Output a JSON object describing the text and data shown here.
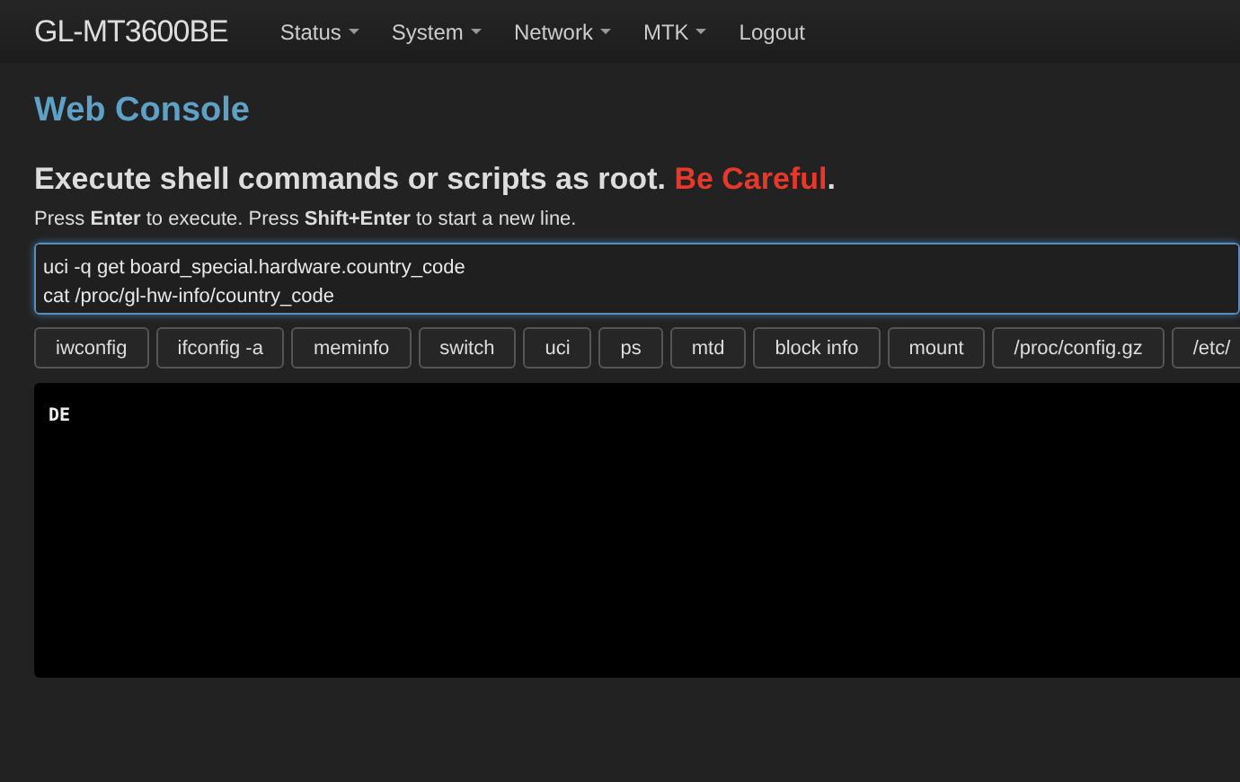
{
  "navbar": {
    "brand": "GL-MT3600BE",
    "menu": [
      {
        "label": "Status",
        "dropdown": true
      },
      {
        "label": "System",
        "dropdown": true
      },
      {
        "label": "Network",
        "dropdown": true
      },
      {
        "label": "MTK",
        "dropdown": true
      },
      {
        "label": "Logout",
        "dropdown": false
      }
    ]
  },
  "page_title": "Web Console",
  "heading": {
    "text": "Execute shell commands or scripts as root. ",
    "warning": "Be Careful",
    "end": "."
  },
  "hint": "Press **Enter** to execute. Press **Shift+Enter** to start a new line.",
  "command_input": {
    "value": "uci -q get board_special.hardware.country_code\ncat /proc/gl-hw-info/country_code"
  },
  "shortcuts": [
    "iwconfig",
    "ifconfig -a",
    "meminfo",
    "switch",
    "uci",
    "ps",
    "mtd",
    "block info",
    "mount",
    "/proc/config.gz",
    "/etc/"
  ],
  "output": "DE"
}
